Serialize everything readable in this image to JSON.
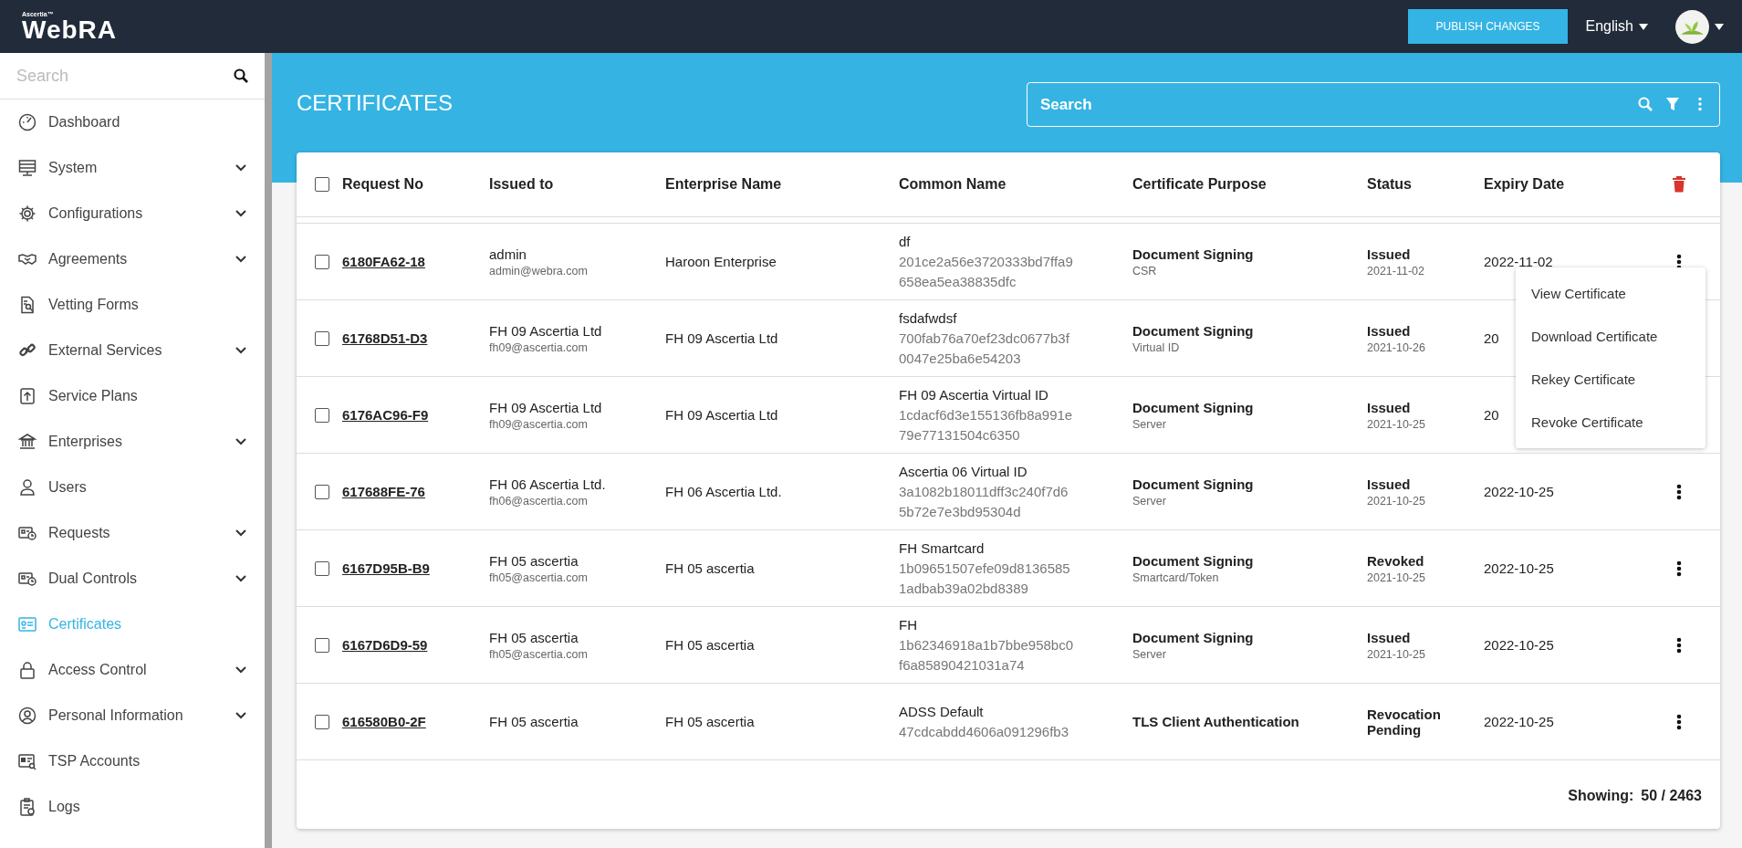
{
  "header": {
    "brand_small": "Ascertia™",
    "brand": "WebRA",
    "publish_button": "PUBLISH CHANGES",
    "language": "English"
  },
  "sidebar": {
    "search": {
      "placeholder": "Search"
    },
    "items": [
      {
        "label": "Dashboard",
        "expandable": false,
        "selected": false
      },
      {
        "label": "System",
        "expandable": true,
        "selected": false
      },
      {
        "label": "Configurations",
        "expandable": true,
        "selected": false
      },
      {
        "label": "Agreements",
        "expandable": true,
        "selected": false
      },
      {
        "label": "Vetting Forms",
        "expandable": false,
        "selected": false
      },
      {
        "label": "External Services",
        "expandable": true,
        "selected": false
      },
      {
        "label": "Service Plans",
        "expandable": false,
        "selected": false
      },
      {
        "label": "Enterprises",
        "expandable": true,
        "selected": false
      },
      {
        "label": "Users",
        "expandable": false,
        "selected": false
      },
      {
        "label": "Requests",
        "expandable": true,
        "selected": false
      },
      {
        "label": "Dual Controls",
        "expandable": true,
        "selected": false
      },
      {
        "label": "Certificates",
        "expandable": false,
        "selected": true
      },
      {
        "label": "Access Control",
        "expandable": true,
        "selected": false
      },
      {
        "label": "Personal Information",
        "expandable": true,
        "selected": false
      },
      {
        "label": "TSP Accounts",
        "expandable": false,
        "selected": false
      },
      {
        "label": "Logs",
        "expandable": false,
        "selected": false
      }
    ]
  },
  "page": {
    "title": "CERTIFICATES",
    "search": {
      "placeholder": "Search"
    }
  },
  "table": {
    "select_all_checked": false,
    "columns": [
      "Request No",
      "Issued to",
      "Enterprise Name",
      "Common Name",
      "Certificate Purpose",
      "Status",
      "Expiry Date"
    ],
    "rows": [
      {
        "request_no": "6180FA62-18",
        "issued_to": "admin",
        "email": "admin@webra.com",
        "enterprise": "Haroon Enterprise",
        "common_name": "df",
        "hash_lines": [
          "201ce2a56e3720333bd7ffa9",
          "658ea5ea38835dfc"
        ],
        "purpose": "Document Signing",
        "purpose_type": "CSR",
        "status": "Issued",
        "status_date": "2021-11-02",
        "expiry": "2022-11-02",
        "checked": false,
        "menu_open": true
      },
      {
        "request_no": "61768D51-D3",
        "issued_to": "FH 09 Ascertia Ltd",
        "email": "fh09@ascertia.com",
        "enterprise": "FH 09 Ascertia Ltd",
        "common_name": "fsdafwdsf",
        "hash_lines": [
          "700fab76a70ef23dc0677b3f",
          "0047e25ba6e54203"
        ],
        "purpose": "Document Signing",
        "purpose_type": "Virtual ID",
        "status": "Issued",
        "status_date": "2021-10-26",
        "expiry": "20",
        "checked": false,
        "menu_open": false,
        "more_button": false
      },
      {
        "request_no": "6176AC96-F9",
        "issued_to": "FH 09 Ascertia Ltd",
        "email": "fh09@ascertia.com",
        "enterprise": "FH 09 Ascertia Ltd",
        "common_name": "FH 09 Ascertia Virtual ID",
        "hash_lines": [
          "1cdacf6d3e155136fb8a991e",
          "79e77131504c6350"
        ],
        "purpose": "Document Signing",
        "purpose_type": "Server",
        "status": "Issued",
        "status_date": "2021-10-25",
        "expiry": "20",
        "checked": false,
        "menu_open": false,
        "more_button": false
      },
      {
        "request_no": "617688FE-76",
        "issued_to": "FH 06 Ascertia Ltd.",
        "email": "fh06@ascertia.com",
        "enterprise": "FH 06 Ascertia Ltd.",
        "common_name": "Ascertia 06 Virtual ID",
        "hash_lines": [
          "3a1082b18011dff3c240f7d6",
          "5b72e7e3bd95304d"
        ],
        "purpose": "Document Signing",
        "purpose_type": "Server",
        "status": "Issued",
        "status_date": "2021-10-25",
        "expiry": "2022-10-25",
        "checked": false,
        "menu_open": false
      },
      {
        "request_no": "6167D95B-B9",
        "issued_to": "FH 05 ascertia",
        "email": "fh05@ascertia.com",
        "enterprise": "FH 05 ascertia",
        "common_name": "FH Smartcard",
        "hash_lines": [
          "1b09651507efe09d8136585",
          "1adbab39a02bd8389"
        ],
        "purpose": "Document Signing",
        "purpose_type": "Smartcard/Token",
        "status": "Revoked",
        "status_date": "2021-10-25",
        "expiry": "2022-10-25",
        "checked": false,
        "menu_open": false
      },
      {
        "request_no": "6167D6D9-59",
        "issued_to": "FH 05 ascertia",
        "email": "fh05@ascertia.com",
        "enterprise": "FH 05 ascertia",
        "common_name": "FH",
        "hash_lines": [
          "1b62346918a1b7bbe958bc0",
          "f6a85890421031a74"
        ],
        "purpose": "Document Signing",
        "purpose_type": "Server",
        "status": "Issued",
        "status_date": "2021-10-25",
        "expiry": "2022-10-25",
        "checked": false,
        "menu_open": false
      },
      {
        "request_no": "616580B0-2F",
        "issued_to": "FH 05 ascertia",
        "enterprise": "FH 05 ascertia",
        "common_name": "ADSS Default",
        "hash_lines": [
          "47cdcabdd4606a091296fb3"
        ],
        "purpose": "TLS Client Authentication",
        "status": "Revocation Pending",
        "expiry": "2022-10-25",
        "checked": false,
        "menu_open": false
      }
    ],
    "row_menu": [
      "View Certificate",
      "Download Certificate",
      "Rekey Certificate",
      "Revoke Certificate"
    ]
  },
  "footer": {
    "label": "Showing:",
    "count": "50 / 2463"
  }
}
